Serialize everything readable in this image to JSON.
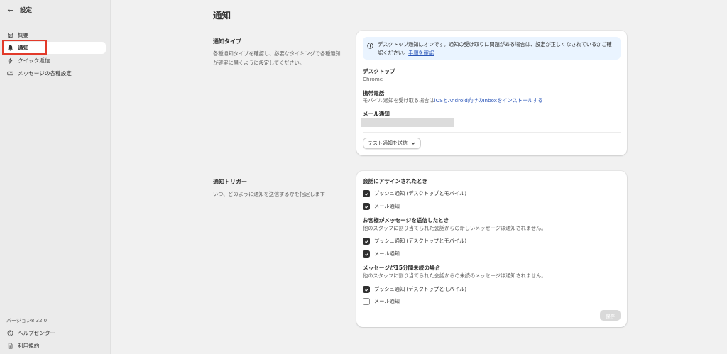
{
  "sidebar": {
    "back_icon": "arrow-left-icon",
    "title": "設定",
    "items": [
      {
        "label": "概要",
        "icon": "store-icon"
      },
      {
        "label": "通知",
        "icon": "bell-icon"
      },
      {
        "label": "クイック返信",
        "icon": "lightning-icon"
      },
      {
        "label": "メッセージの各種設定",
        "icon": "keyboard-icon"
      }
    ],
    "version": "バージョン8.32.0",
    "footer": [
      {
        "label": "ヘルプセンター",
        "icon": "help-circle-icon"
      },
      {
        "label": "利用規約",
        "icon": "document-icon"
      }
    ]
  },
  "main": {
    "page_title": "通知",
    "types_section": {
      "title": "通知タイプ",
      "description": "各種通知タイプを確認し、必要なタイミングで各種通知が確実に届くように設定してください。"
    },
    "types_card": {
      "banner_text": "デスクトップ通知はオンです。通知の受け取りに問題がある場合は、設定が正しくなされているかご確認ください。",
      "banner_link": "手順を確認",
      "desktop_label": "デスクトップ",
      "desktop_value": "Chrome",
      "mobile_label": "携帯電話",
      "mobile_prefix": "モバイル通知を受け取る場合は",
      "mobile_link": "iOSとAndroid向けのInboxをインストールする",
      "email_label": "メール通知",
      "test_button": "テスト通知を送信"
    },
    "triggers_section": {
      "title": "通知トリガー",
      "description": "いつ、どのように通知を送信するかを指定します"
    },
    "triggers_card": {
      "groups": [
        {
          "title": "会話にアサインされたとき",
          "subtitle": "",
          "options": [
            {
              "label": "プッシュ通知 (デスクトップとモバイル)",
              "checked": true
            },
            {
              "label": "メール通知",
              "checked": true
            }
          ]
        },
        {
          "title": "お客様がメッセージを送信したとき",
          "subtitle": "他のスタッフに割り当てられた会話からの新しいメッセージは通知されません。",
          "options": [
            {
              "label": "プッシュ通知 (デスクトップとモバイル)",
              "checked": true
            },
            {
              "label": "メール通知",
              "checked": true
            }
          ]
        },
        {
          "title": "メッセージが15分間未読の場合",
          "subtitle": "他のスタッフに割り当てられた会話からの未読のメッセージは通知されません。",
          "options": [
            {
              "label": "プッシュ通知 (デスクトップとモバイル)",
              "checked": true
            },
            {
              "label": "メール通知",
              "checked": false
            }
          ]
        }
      ],
      "save_button": "保存"
    }
  },
  "colors": {
    "annotation_highlight": "#e23a2a",
    "link": "#2a55b8",
    "banner_bg": "#eaf4ff"
  }
}
